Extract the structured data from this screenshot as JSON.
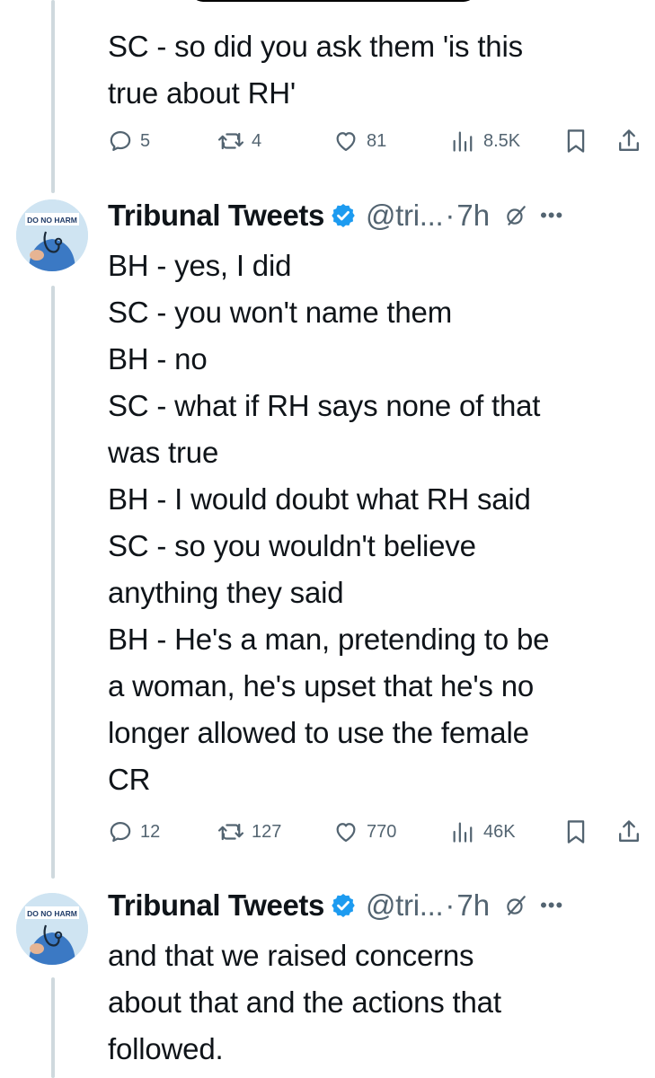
{
  "tweets": [
    {
      "text": "SC - so did you ask them 'is this\ntrue about RH'",
      "stats": {
        "replies": "5",
        "retweets": "4",
        "likes": "81",
        "views": "8.5K"
      }
    },
    {
      "author": {
        "name": "Tribunal Tweets",
        "handle": "@tri...",
        "separator": "·",
        "time": "7h",
        "avatar_text": "DO NO HARM"
      },
      "text": "BH - yes, I did\nSC - you won't name them\nBH - no\nSC - what if RH says none of that\nwas true\nBH - I would doubt what RH said\nSC - so you wouldn't believe\nanything they said\nBH - He's a man, pretending to be\na woman, he's upset that he's no\nlonger allowed to use the female\nCR",
      "stats": {
        "replies": "12",
        "retweets": "127",
        "likes": "770",
        "views": "46K"
      }
    },
    {
      "author": {
        "name": "Tribunal Tweets",
        "handle": "@tri...",
        "separator": "·",
        "time": "7h",
        "avatar_text": "DO NO HARM"
      },
      "text": "and that we raised concerns\nabout that and the actions that\nfollowed."
    }
  ],
  "icons": {
    "reply": "reply-icon",
    "retweet": "retweet-icon",
    "like": "heart-icon",
    "views": "views-icon",
    "bookmark": "bookmark-icon",
    "share": "share-icon",
    "verified": "verified-badge-icon",
    "grok": "grok-icon",
    "more": "more-icon"
  },
  "colors": {
    "text": "#0f1419",
    "secondary": "#536471",
    "verified": "#1d9bf0",
    "thread_line": "#cfd9de"
  }
}
